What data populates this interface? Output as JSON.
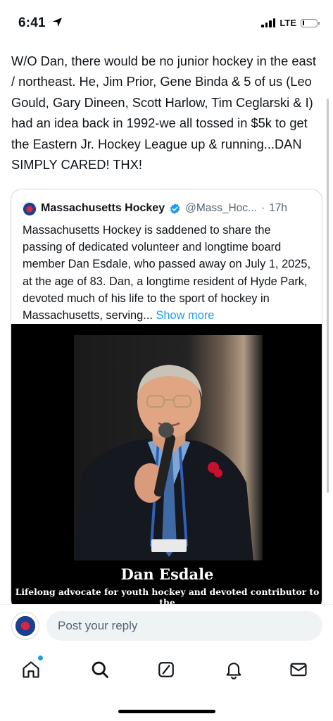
{
  "status_bar": {
    "time": "6:41",
    "network": "LTE",
    "signal_bars": 4,
    "battery_level": 0.12
  },
  "tweet": {
    "text": "W/O Dan, there would be no junior hockey in the east / northeast. He, Jim Prior, Gene Binda & 5 of us (Leo Gould, Gary Dineen, Scott Harlow, Tim Ceglarski & I) had an idea back in 1992-we all tossed in $5k to get the Eastern Jr. Hockey League up & running...DAN SIMPLY CARED! THX!"
  },
  "quote": {
    "name": "Massachusetts Hockey",
    "handle": "@Mass_Hoc...",
    "separator": "·",
    "time": "17h",
    "body": "Massachusetts Hockey is saddened to share the passing of dedicated volunteer and longtime board member Dan Esdale, who passed away on July 1, 2025, at the age of 83. Dan, a longtime resident of Hyde Park, devoted much of his life to the sport of hockey in Massachusetts, serving...",
    "show_more": "Show more",
    "media": {
      "person_name": "Dan Esdale",
      "caption": "Lifelong advocate for youth hockey and devoted contributor to the"
    }
  },
  "reply": {
    "placeholder": "Post your reply"
  },
  "tab_bar": {
    "tabs": [
      "home-icon",
      "search-icon",
      "grok-icon",
      "notifications-icon",
      "messages-icon"
    ]
  },
  "colors": {
    "accent": "#1d9bf0",
    "text": "#0f1419",
    "secondary": "#536471",
    "border": "#cfd9de"
  }
}
